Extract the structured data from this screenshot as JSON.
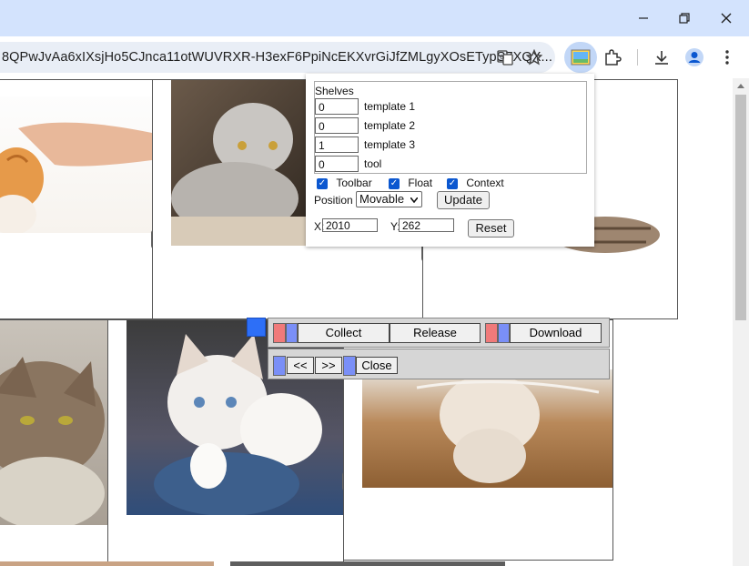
{
  "browser": {
    "url": "8QPwJvAa6xIXsjHo5CJnca11otWUVRXR-H3exF6PpiNcEKXvrGiJfZMLgyXOsETypS7XQX..."
  },
  "panel": {
    "shelves_label": "Shelves",
    "shelves": [
      {
        "value": "0",
        "label": "template 1"
      },
      {
        "value": "0",
        "label": "template 2"
      },
      {
        "value": "1",
        "label": "template 3"
      },
      {
        "value": "0",
        "label": "tool"
      }
    ],
    "options": [
      {
        "label": "Toolbar",
        "checked": true
      },
      {
        "label": "Float",
        "checked": true
      },
      {
        "label": "Context",
        "checked": true
      }
    ],
    "position_label": "Position",
    "position_value": "Movable",
    "update_label": "Update",
    "x_label": "X:",
    "x_value": "2010",
    "y_label": "Y:",
    "y_value": "262",
    "reset_label": "Reset"
  },
  "float_toolbar": {
    "collect_label": "Collect",
    "release_label": "Release",
    "download_label": "Download",
    "prev_label": "<<",
    "next_label": ">>",
    "close_label": "Close"
  },
  "colors": {
    "accent_blue": "#2d6ff7",
    "swatch_red": "#f07a7a",
    "swatch_blue": "#7a8ff7",
    "titlebar": "#d3e3fd"
  }
}
